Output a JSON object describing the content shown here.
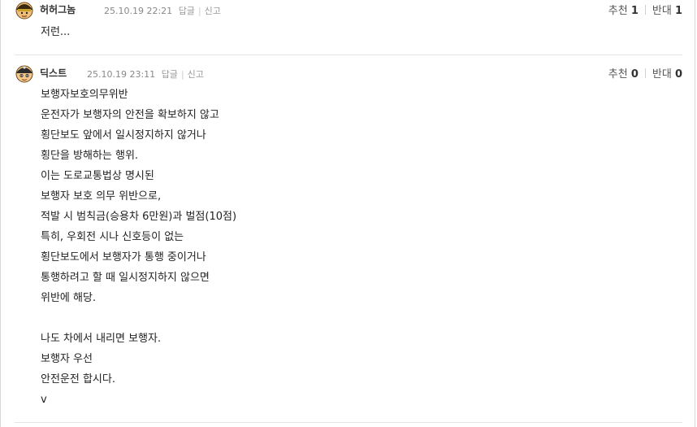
{
  "comments": [
    {
      "author": "허허그놈",
      "timestamp": "25.10.19 22:21",
      "reply_label": "답글",
      "report_label": "신고",
      "upvote_label": "추천",
      "upvote_count": "1",
      "downvote_label": "반대",
      "downvote_count": "1",
      "body": "저런..."
    },
    {
      "author": "딕스트",
      "timestamp": "25.10.19 23:11",
      "reply_label": "답글",
      "report_label": "신고",
      "upvote_label": "추천",
      "upvote_count": "0",
      "downvote_label": "반대",
      "downvote_count": "0",
      "body": "보행자보호의무위반\n운전자가 보행자의 안전을 확보하지 않고\n횡단보도 앞에서 일시정지하지 않거나\n횡단을 방해하는 행위.\n이는 도로교통법상 명시된\n보행자 보호 의무 위반으로,\n적발 시 범칙금(승용차 6만원)과 벌점(10점)\n특히, 우회전 시나 신호등이 없는\n횡단보도에서 보행자가 통행 중이거나\n통행하려고 할 때 일시정지하지 않으면\n위반에 해당.\n\n나도 차에서 내리면 보행자.\n보행자 우선\n안전운전 합시다.\nv"
    }
  ]
}
